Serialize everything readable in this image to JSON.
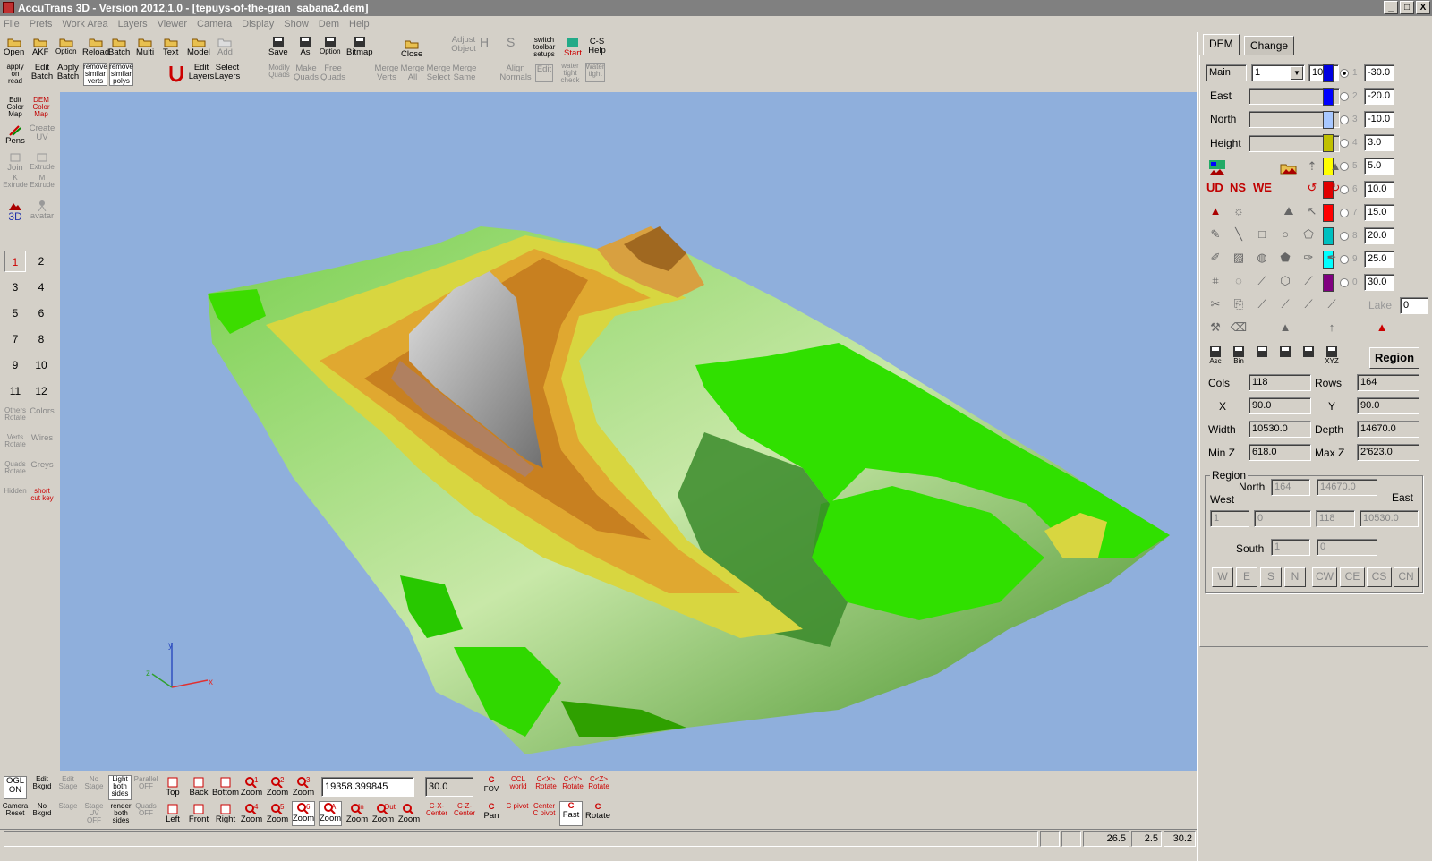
{
  "window": {
    "title": "AccuTrans 3D - Version 2012.1.0 - [tepuys-of-the-gran_sabana2.dem]",
    "controls": [
      "_",
      "□",
      "X"
    ]
  },
  "menu": [
    "File",
    "Prefs",
    "Work Area",
    "Layers",
    "Viewer",
    "Camera",
    "Display",
    "Show",
    "Dem",
    "Help"
  ],
  "toolbar_top": {
    "row1": [
      {
        "l": "Open"
      },
      {
        "l": "AKF"
      },
      {
        "l": "Option"
      },
      {
        "l": "Reload"
      },
      {
        "l": "Batch"
      },
      {
        "l": "Multi"
      },
      {
        "l": "Text"
      },
      {
        "l": "Model"
      },
      {
        "l": "Add",
        "dis": true
      }
    ],
    "row2": [
      {
        "l": "apply on read"
      },
      {
        "l": "Edit Batch"
      },
      {
        "l": "Apply Batch"
      },
      {
        "l": "remove similar verts"
      },
      {
        "l": "remove similar polys"
      }
    ],
    "layers": [
      "Edit Layers",
      "Select Layers"
    ],
    "save": [
      "Save",
      "As",
      "Option",
      "Bitmap"
    ],
    "save2": [
      "Modify Quads",
      "Make Quads",
      "Free Quads"
    ],
    "close": "Close",
    "merge": [
      "Merge Verts",
      "Merge All",
      "Merge Select",
      "Merge Same"
    ],
    "adjust": [
      "Adjust Object",
      "Align Normals",
      "Edit"
    ],
    "switch": [
      "switch toolbar setups",
      "water tight check",
      "Water tight"
    ],
    "help": [
      "Start",
      "C-S Help"
    ]
  },
  "left_toolbar": {
    "items": [
      "Edit Color Map",
      "DEM Color Map",
      "Pens",
      "Create UV",
      "Join",
      "Extrude",
      "K Extrude",
      "M Extrude",
      "3D",
      "avatar"
    ],
    "presets": [
      "1",
      "2",
      "3",
      "4",
      "5",
      "6",
      "7",
      "8",
      "9",
      "10",
      "11",
      "12"
    ],
    "bottom": [
      "Others Rotate",
      "Colors",
      "Verts Rotate",
      "Wires",
      "Quads Rotate",
      "Greys",
      "Hidden",
      "short cut key"
    ]
  },
  "viewport": {
    "axes": {
      "y": "y",
      "x": "x",
      "z": "z"
    }
  },
  "bottom_toolbar": {
    "row1": [
      "OGL ON",
      "Edit Bkgrd",
      "Edit Stage",
      "No Stage",
      "Light both sides",
      "Parallel OFF",
      "Top",
      "Back",
      "Bottom",
      "Zoom",
      "Zoom",
      "Zoom"
    ],
    "row1_nums": [
      "1",
      "2",
      "3"
    ],
    "distance": "19358.399845",
    "fov": "30.0",
    "row1b": [
      "FOV",
      "CCL world",
      "C<X> Rotate",
      "C<Y> Rotate",
      "C<Z> Rotate"
    ],
    "row2": [
      "Camera Reset",
      "No Bkgrd",
      "Stage",
      "Stage UV OFF",
      "render both sides",
      "Quads OFF",
      "Left",
      "Front",
      "Right",
      "Zoom",
      "Zoom",
      "Zoom"
    ],
    "row2_nums": [
      "4",
      "5",
      "6"
    ],
    "row2b": [
      "Zoom",
      "Zoom",
      "Zoom",
      "Zoom",
      "C-X- Center",
      "C-Z- Center",
      "Pan",
      "C pivot",
      "Center C pivot",
      "Fast",
      "Rotate"
    ],
    "row2b_tags": [
      "A",
      "In",
      "Out",
      ""
    ]
  },
  "status": [
    "26.5",
    "2.5",
    "30.2"
  ],
  "panel": {
    "tabs": [
      "DEM",
      "Change"
    ],
    "main_label": "Main",
    "main_select": "1",
    "main_count": "10",
    "east_label": "East",
    "north_label": "North",
    "height_label": "Height",
    "colors": [
      {
        "n": "1",
        "v": "-30.0",
        "c": "#0000e0"
      },
      {
        "n": "2",
        "v": "-20.0",
        "c": "#0000ff"
      },
      {
        "n": "3",
        "v": "-10.0",
        "c": "#a8c8ff"
      },
      {
        "n": "4",
        "v": "3.0",
        "c": "#c0c000"
      },
      {
        "n": "5",
        "v": "5.0",
        "c": "#ffff00"
      },
      {
        "n": "6",
        "v": "10.0",
        "c": "#e00000"
      },
      {
        "n": "7",
        "v": "15.0",
        "c": "#ff0000"
      },
      {
        "n": "8",
        "v": "20.0",
        "c": "#00c0c0"
      },
      {
        "n": "9",
        "v": "25.0",
        "c": "#00ffff"
      },
      {
        "n": "0",
        "v": "30.0",
        "c": "#800080"
      }
    ],
    "lake_label": "Lake",
    "lake_value": "0",
    "tool_labels": [
      "UD",
      "NS",
      "WE"
    ],
    "save_labels": [
      "Asc",
      "Bin",
      "",
      "",
      "",
      "XYZ"
    ],
    "region_button": "Region",
    "cols_label": "Cols",
    "cols": "118",
    "rows_label": "Rows",
    "rows": "164",
    "x_label": "X",
    "x": "90.0",
    "y_label": "Y",
    "y": "90.0",
    "width_label": "Width",
    "width": "10530.0",
    "depth_label": "Depth",
    "depth": "14670.0",
    "minz_label": "Min Z",
    "minz": "618.0",
    "maxz_label": "Max  Z",
    "maxz": "2'623.0",
    "region": {
      "title": "Region",
      "north_label": "North",
      "north1": "164",
      "north2": "14670.0",
      "west_label": "West",
      "east_label": "East",
      "w1": "1",
      "w2": "0",
      "e1": "118",
      "e2": "10530.0",
      "south_label": "South",
      "s1": "1",
      "s2": "0"
    },
    "dir_buttons": [
      "W",
      "E",
      "S",
      "N",
      "CW",
      "CE",
      "CS",
      "CN"
    ]
  }
}
